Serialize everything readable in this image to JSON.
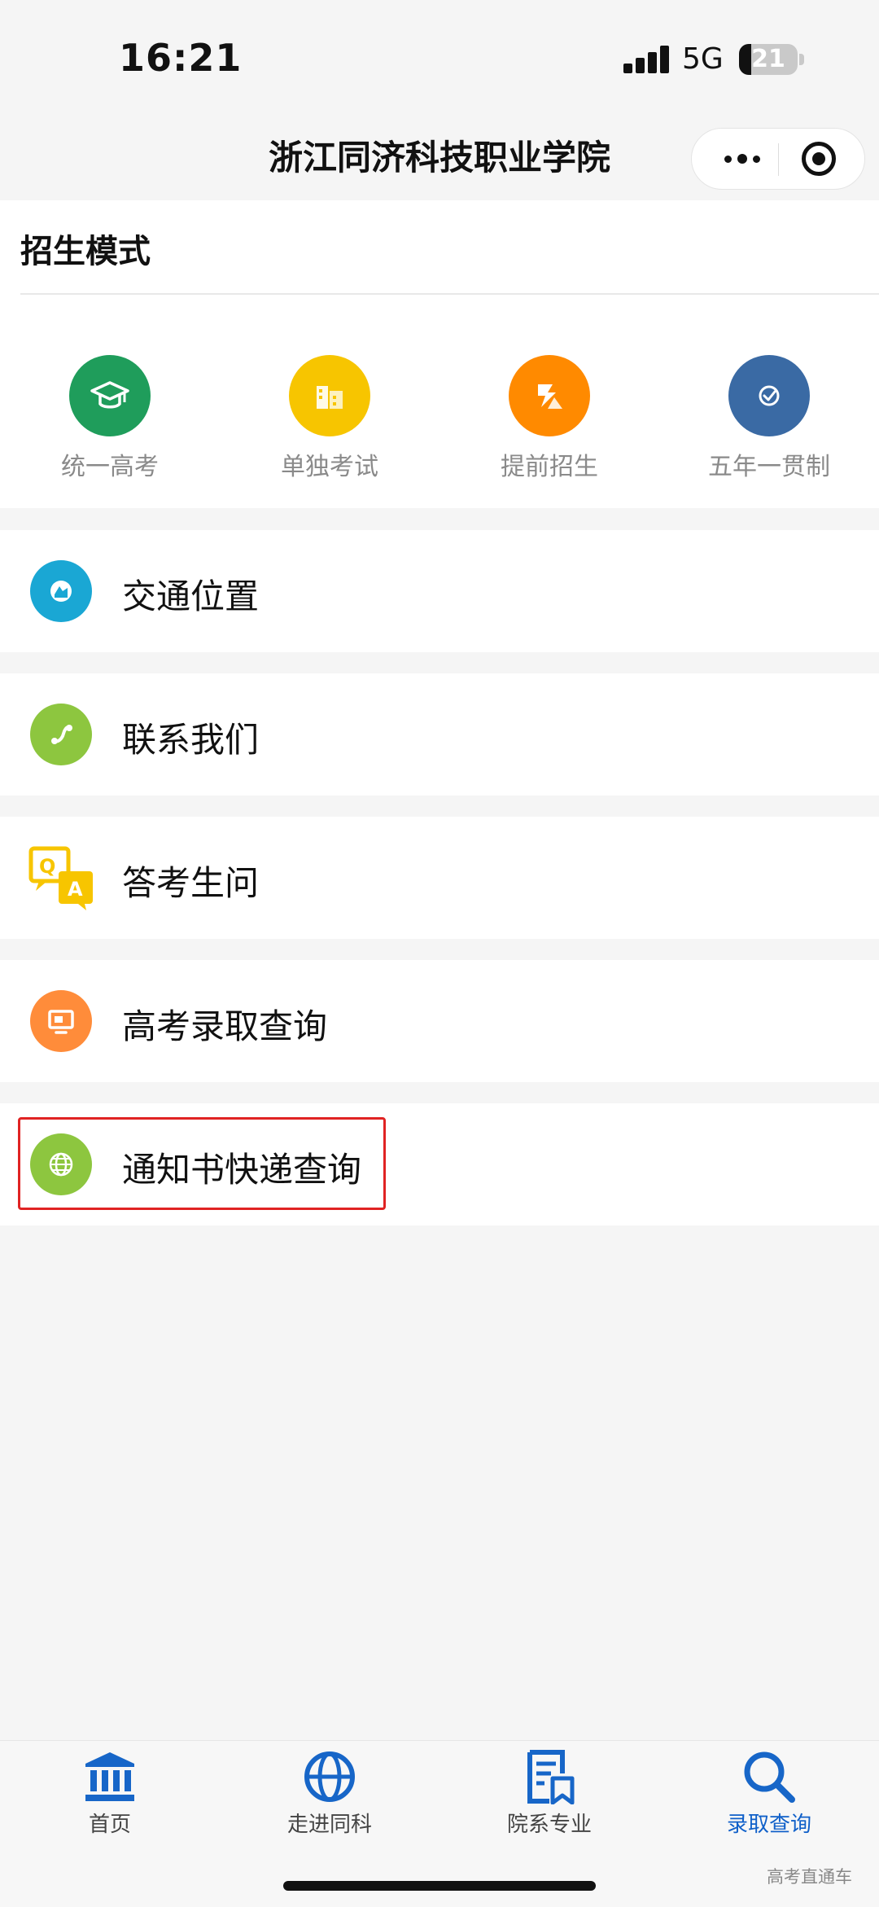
{
  "status_bar": {
    "time": "16:21",
    "network": "5G",
    "battery_level": "21",
    "battery_fraction": 0.21
  },
  "navbar": {
    "title": "浙江同济科技职业学院",
    "more_icon": "more-dots-icon",
    "close_icon": "target-circle-icon"
  },
  "admission_modes": {
    "title": "招生模式",
    "items": [
      {
        "label": "统一高考",
        "icon": "graduation-cap-icon",
        "color": "#1f9d5b"
      },
      {
        "label": "单独考试",
        "icon": "building-icon",
        "color": "#f7c500"
      },
      {
        "label": "提前招生",
        "icon": "arrow-triangle-icon",
        "color": "#ff8a00"
      },
      {
        "label": "五年一贯制",
        "icon": "check-circle-icon",
        "color": "#3a6aa4"
      }
    ]
  },
  "menu": [
    {
      "label": "交通位置",
      "icon": "location-icon",
      "color": "#1aa7d4"
    },
    {
      "label": "联系我们",
      "icon": "phone-icon",
      "color": "#8dc63f"
    },
    {
      "label": "答考生问",
      "icon": "qa-icon",
      "color": "#f7c500"
    },
    {
      "label": "高考录取查询",
      "icon": "monitor-icon",
      "color": "#ff8c3a"
    },
    {
      "label": "通知书快递查询",
      "icon": "globe-icon",
      "color": "#8dc63f",
      "highlighted": true
    }
  ],
  "tabbar": {
    "items": [
      {
        "label": "首页",
        "icon": "bank-building-icon"
      },
      {
        "label": "走进同科",
        "icon": "globe-icon"
      },
      {
        "label": "院系专业",
        "icon": "document-bookmark-icon"
      },
      {
        "label": "录取查询",
        "icon": "search-icon",
        "active": true
      }
    ],
    "active_color": "#1060c9",
    "icon_color": "#1766c8"
  },
  "watermark": "高考直通车"
}
